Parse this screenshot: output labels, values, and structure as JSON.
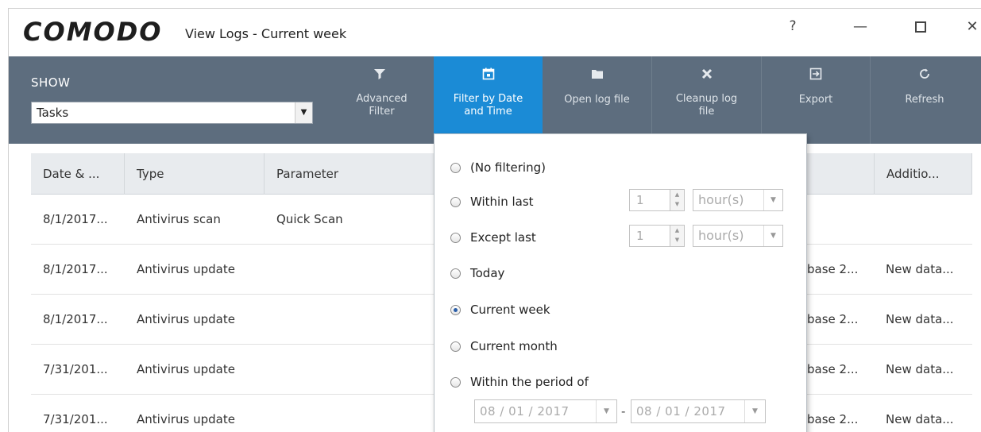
{
  "window": {
    "brand": "COMODO",
    "title": "View Logs - Current week",
    "controls": {
      "help": "?",
      "minimize": "—",
      "close": "✕"
    }
  },
  "toolbar": {
    "show_label": "SHOW",
    "show_value": "Tasks",
    "buttons": [
      {
        "icon": "filter-icon",
        "label": "Advanced Filter"
      },
      {
        "icon": "calendar-icon",
        "label": "Filter by Date and Time",
        "active": true
      },
      {
        "icon": "folder-icon",
        "label": "Open log file"
      },
      {
        "icon": "cleanup-x-icon",
        "label": "Cleanup log file"
      },
      {
        "icon": "export-icon",
        "label": "Export"
      },
      {
        "icon": "refresh-icon",
        "label": "Refresh"
      }
    ],
    "accent_color": "#1b8bd6",
    "bar_color": "#5d6d7e"
  },
  "table": {
    "columns": [
      "Date & ...",
      "Type",
      "Parameter",
      "Additio..."
    ],
    "rows": [
      {
        "date": "8/1/2017...",
        "type": "Antivirus scan",
        "parameter": "Quick Scan",
        "partial": "",
        "additional": ""
      },
      {
        "date": "8/1/2017...",
        "type": "Antivirus update",
        "parameter": "",
        "partial": "base 2...",
        "additional": "New data..."
      },
      {
        "date": "8/1/2017...",
        "type": "Antivirus update",
        "parameter": "",
        "partial": "base 2...",
        "additional": "New data..."
      },
      {
        "date": "7/31/201...",
        "type": "Antivirus update",
        "parameter": "",
        "partial": "base 2...",
        "additional": "New data..."
      },
      {
        "date": "7/31/201...",
        "type": "Antivirus update",
        "parameter": "",
        "partial": "base 2...",
        "additional": "New data..."
      }
    ]
  },
  "filter_panel": {
    "options": [
      {
        "label": "(No filtering)",
        "checked": false
      },
      {
        "label": "Within last",
        "checked": false
      },
      {
        "label": "Except last",
        "checked": false
      },
      {
        "label": "Today",
        "checked": false
      },
      {
        "label": "Current week",
        "checked": true
      },
      {
        "label": "Current month",
        "checked": false
      },
      {
        "label": "Within the period of",
        "checked": false
      }
    ],
    "within_last": {
      "value": "1",
      "unit": "hour(s)"
    },
    "except_last": {
      "value": "1",
      "unit": "hour(s)"
    },
    "period": {
      "from": "08 / 01 / 2017",
      "to": "08 / 01 / 2017",
      "separator": "-"
    }
  }
}
